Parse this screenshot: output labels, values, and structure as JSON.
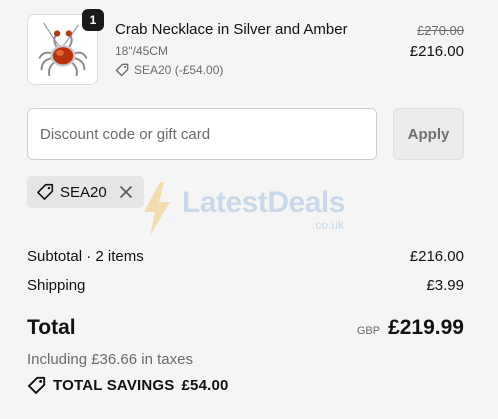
{
  "line_item": {
    "quantity": "1",
    "title": "Crab Necklace in Silver and Amber",
    "variant": "18\"/45CM",
    "discount": "SEA20 (-£54.00)",
    "price_original": "£270.00",
    "price_final": "£216.00",
    "thumbnail_icon": "crab-necklace-image"
  },
  "discount_form": {
    "placeholder": "Discount code or gift card",
    "value": "",
    "apply_label": "Apply"
  },
  "applied_code": {
    "code": "SEA20",
    "tag_icon": "tag-icon",
    "remove_icon": "close-icon"
  },
  "watermark": {
    "text": "LatestDeals",
    "suffix": ".co.uk"
  },
  "summary": {
    "subtotal_label": "Subtotal · 2 items",
    "subtotal_value": "£216.00",
    "shipping_label": "Shipping",
    "shipping_value": "£3.99",
    "total_label": "Total",
    "currency": "GBP",
    "total_value": "£219.99",
    "taxes_note": "Including £36.66 in taxes",
    "savings_label": "TOTAL SAVINGS",
    "savings_value": "£54.00"
  },
  "colors": {
    "background": "#f5f5f5",
    "text": "#111111",
    "muted": "#6b6b6b",
    "watermark": "#7aa6d6",
    "watermark_bolt": "#f2b233"
  }
}
